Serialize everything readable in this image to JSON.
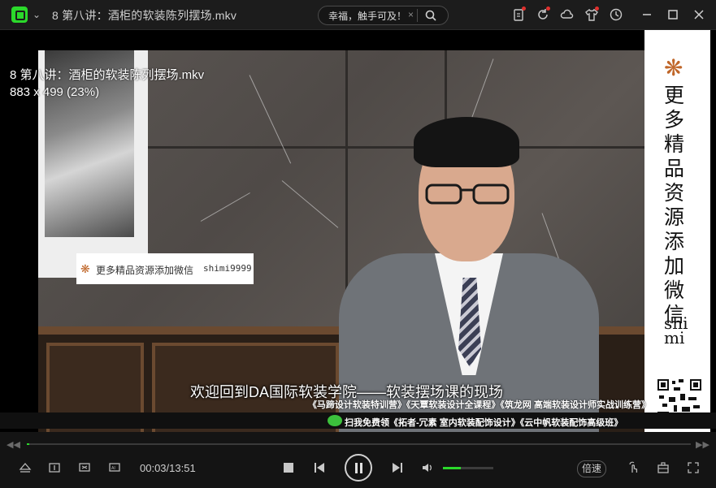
{
  "titlebar": {
    "file_title": "8 第八讲：酒柜的软装陈列摆场.mkv",
    "search_text": "幸福，触手可及！",
    "search_clear": "×",
    "brand_color": "#2bd92b"
  },
  "video": {
    "overlay_filename": "8 第八讲：酒柜的软装陈列摆场.mkv",
    "overlay_size": "883 x 499 (23%)",
    "watermark_text": "更多精品资源添加微信",
    "watermark_code": "shimi9999",
    "sidebar_text": "更多精品资源添加微信",
    "sidebar_code": "shimi",
    "subtitle": "欢迎回到DA国际软装学院——软装摆场课的现场",
    "ad_line1": "《马蹄设计软装特训营》《天覃软装设计全课程》《筑龙网 高端软装设计师实战训练营》",
    "ad_line2": "扫我免费领《拓者-冗素 室内软装配饰设计》《云中帆软装配饰高级班》"
  },
  "controls": {
    "time": "00:03/13:51",
    "progress": 0.004,
    "volume": 0.35,
    "speed_label": "倍速"
  }
}
